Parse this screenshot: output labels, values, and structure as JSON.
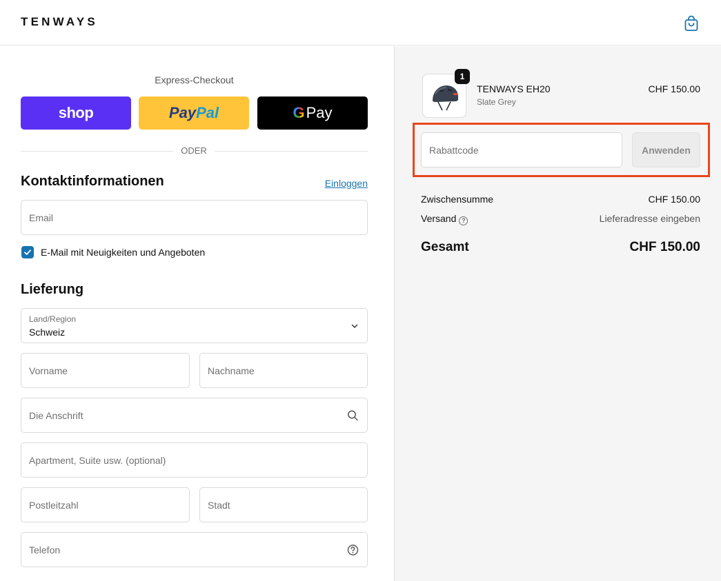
{
  "header": {
    "logo": "TENWAYS",
    "cart_icon": "shopping-bag-icon"
  },
  "express": {
    "title": "Express-Checkout",
    "shop_label": "shop",
    "paypal_label_1": "Pay",
    "paypal_label_2": "Pal",
    "gpay_g": "G",
    "gpay_label": "Pay",
    "divider_label": "ODER"
  },
  "contact": {
    "title": "Kontaktinformationen",
    "login_label": "Einloggen",
    "email_placeholder": "Email",
    "newsletter_checked": true,
    "newsletter_label": "E-Mail mit Neuigkeiten und Angeboten"
  },
  "delivery": {
    "title": "Lieferung",
    "country_label": "Land/Region",
    "country_value": "Schweiz",
    "first_name_placeholder": "Vorname",
    "last_name_placeholder": "Nachname",
    "address_placeholder": "Die Anschrift",
    "apartment_placeholder": "Apartment, Suite usw. (optional)",
    "postal_placeholder": "Postleitzahl",
    "city_placeholder": "Stadt",
    "phone_placeholder": "Telefon"
  },
  "order": {
    "item": {
      "quantity": "1",
      "name": "TENWAYS EH20",
      "variant": "Slate Grey",
      "price": "CHF 150.00"
    },
    "discount_placeholder": "Rabattcode",
    "apply_label": "Anwenden",
    "subtotal_label": "Zwischensumme",
    "subtotal_value": "CHF 150.00",
    "shipping_label": "Versand",
    "shipping_value": "Lieferadresse eingeben",
    "total_label": "Gesamt",
    "total_value": "CHF 150.00"
  },
  "colors": {
    "shop": "#5a31f4",
    "paypal": "#ffc439",
    "link": "#1773b0",
    "highlight": "#e8461d"
  }
}
